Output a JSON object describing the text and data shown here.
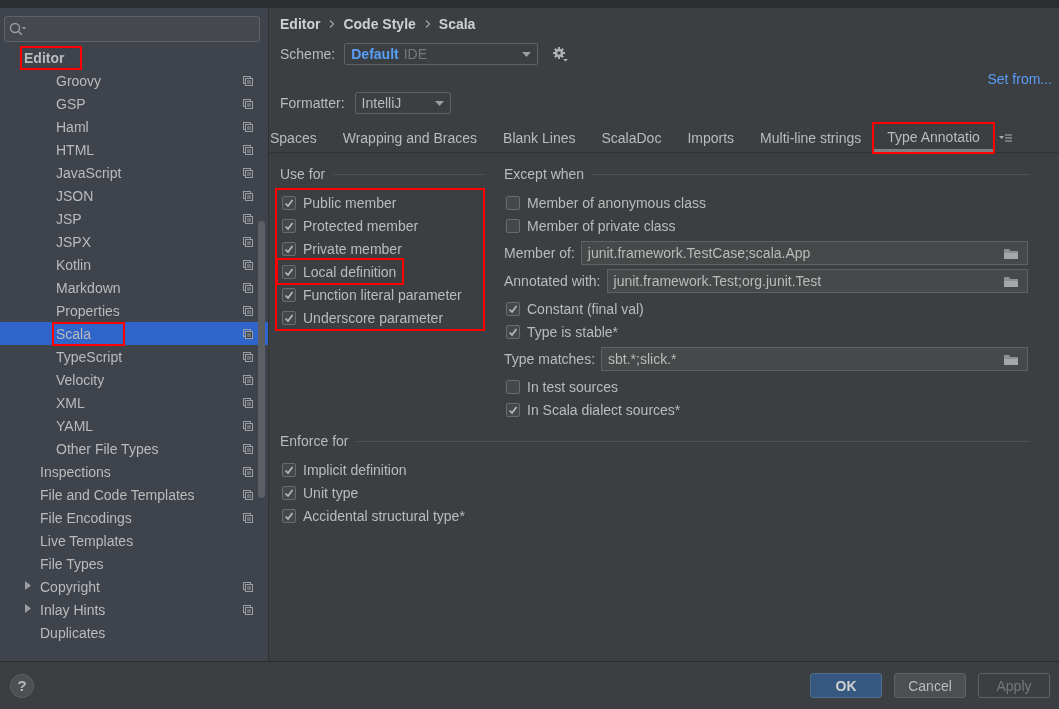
{
  "sidebar": {
    "tree": [
      {
        "label": "Editor",
        "selected": false,
        "highlighted": true,
        "project_scope": false,
        "children": [
          {
            "children": [
              {
                "label": "Groovy",
                "selected": false,
                "highlighted": false,
                "project_scope": true
              },
              {
                "label": "GSP",
                "selected": false,
                "highlighted": false,
                "project_scope": true
              },
              {
                "label": "Haml",
                "selected": false,
                "highlighted": false,
                "project_scope": true
              },
              {
                "label": "HTML",
                "selected": false,
                "highlighted": false,
                "project_scope": true
              },
              {
                "label": "JavaScript",
                "selected": false,
                "highlighted": false,
                "project_scope": true
              },
              {
                "label": "JSON",
                "selected": false,
                "highlighted": false,
                "project_scope": true
              },
              {
                "label": "JSP",
                "selected": false,
                "highlighted": false,
                "project_scope": true
              },
              {
                "label": "JSPX",
                "selected": false,
                "highlighted": false,
                "project_scope": true
              },
              {
                "label": "Kotlin",
                "selected": false,
                "highlighted": false,
                "project_scope": true
              },
              {
                "label": "Markdown",
                "selected": false,
                "highlighted": false,
                "project_scope": true
              },
              {
                "label": "Properties",
                "selected": false,
                "highlighted": false,
                "project_scope": true
              },
              {
                "label": "Scala",
                "selected": true,
                "highlighted": true,
                "project_scope": true
              },
              {
                "label": "TypeScript",
                "selected": false,
                "highlighted": false,
                "project_scope": true
              },
              {
                "label": "Velocity",
                "selected": false,
                "highlighted": false,
                "project_scope": true
              },
              {
                "label": "XML",
                "selected": false,
                "highlighted": false,
                "project_scope": true
              },
              {
                "label": "YAML",
                "selected": false,
                "highlighted": false,
                "project_scope": true
              },
              {
                "label": "Other File Types",
                "selected": false,
                "highlighted": false,
                "project_scope": true
              }
            ]
          },
          {
            "label": "Inspections",
            "selected": false,
            "highlighted": false,
            "project_scope": true
          },
          {
            "label": "File and Code Templates",
            "selected": false,
            "highlighted": false,
            "project_scope": true
          },
          {
            "label": "File Encodings",
            "selected": false,
            "highlighted": false,
            "project_scope": true
          },
          {
            "label": "Live Templates",
            "selected": false,
            "highlighted": false,
            "project_scope": false
          },
          {
            "label": "File Types",
            "selected": false,
            "highlighted": false,
            "project_scope": false
          },
          {
            "label": "Copyright",
            "selected": false,
            "highlighted": false,
            "project_scope": true,
            "expanded": false
          },
          {
            "label": "Inlay Hints",
            "selected": false,
            "highlighted": false,
            "project_scope": true,
            "expanded": false
          },
          {
            "label": "Duplicates",
            "selected": false,
            "highlighted": false,
            "project_scope": false
          }
        ]
      }
    ]
  },
  "main": {
    "breadcrumb": [
      "Editor",
      "Code Style",
      "Scala"
    ],
    "scheme": {
      "label": "Scheme:",
      "name": "Default",
      "level_label": "IDE"
    },
    "set_from": "Set from...",
    "formatter": {
      "label": "Formatter:",
      "value": "IntelliJ"
    },
    "tabs": [
      {
        "label": "Spaces",
        "selected": false,
        "highlighted": false
      },
      {
        "label": "Wrapping and Braces",
        "selected": false,
        "highlighted": false
      },
      {
        "label": "Blank Lines",
        "selected": false,
        "highlighted": false
      },
      {
        "label": "ScalaDoc",
        "selected": false,
        "highlighted": false
      },
      {
        "label": "Imports",
        "selected": false,
        "highlighted": false
      },
      {
        "label": "Multi-line strings",
        "selected": false,
        "highlighted": false
      },
      {
        "label": "Type Annotatio",
        "selected": true,
        "highlighted": true
      }
    ],
    "use_for": {
      "title": "Use for",
      "highlighted": true,
      "items": [
        {
          "kind": "checkbox",
          "label": "Public member",
          "checked": true,
          "highlighted": false
        },
        {
          "kind": "checkbox",
          "label": "Protected member",
          "checked": true,
          "highlighted": false
        },
        {
          "kind": "checkbox",
          "label": "Private member",
          "checked": true,
          "highlighted": false
        },
        {
          "kind": "checkbox",
          "label": "Local definition",
          "checked": true,
          "highlighted": true
        },
        {
          "kind": "checkbox",
          "label": "Function literal parameter",
          "checked": true,
          "highlighted": false
        },
        {
          "kind": "checkbox",
          "label": "Underscore parameter",
          "checked": true,
          "highlighted": false
        }
      ]
    },
    "except_when": {
      "title": "Except when",
      "highlighted": false,
      "items": [
        {
          "kind": "checkbox",
          "label": "Member of anonymous class",
          "checked": false,
          "highlighted": false
        },
        {
          "kind": "checkbox",
          "label": "Member of private class",
          "checked": false,
          "highlighted": false
        },
        {
          "kind": "field",
          "label": "Member of:",
          "value": "junit.framework.TestCase;scala.App"
        },
        {
          "kind": "field",
          "label": "Annotated with:",
          "value": "junit.framework.Test;org.junit.Test"
        },
        {
          "kind": "checkbox",
          "label": "Constant (final val)",
          "checked": true,
          "highlighted": false
        },
        {
          "kind": "checkbox",
          "label": "Type is stable*",
          "checked": true,
          "highlighted": false
        },
        {
          "kind": "field",
          "label": "Type matches:",
          "value": "sbt.*;slick.*"
        },
        {
          "kind": "checkbox",
          "label": "In test sources",
          "checked": false,
          "highlighted": false
        },
        {
          "kind": "checkbox",
          "label": "In Scala dialect sources*",
          "checked": true,
          "highlighted": false
        }
      ]
    },
    "enforce_for": {
      "title": "Enforce for",
      "highlighted": false,
      "items": [
        {
          "kind": "checkbox",
          "label": "Implicit definition",
          "checked": true,
          "highlighted": false
        },
        {
          "kind": "checkbox",
          "label": "Unit type",
          "checked": true,
          "highlighted": false
        },
        {
          "kind": "checkbox",
          "label": "Accidental structural type*",
          "checked": true,
          "highlighted": false
        }
      ]
    }
  },
  "footer": {
    "help": "?",
    "buttons": [
      {
        "label": "OK",
        "kind": "primary",
        "disabled": false
      },
      {
        "label": "Cancel",
        "kind": "normal",
        "disabled": false
      },
      {
        "label": "Apply",
        "kind": "normal",
        "disabled": true
      }
    ]
  }
}
